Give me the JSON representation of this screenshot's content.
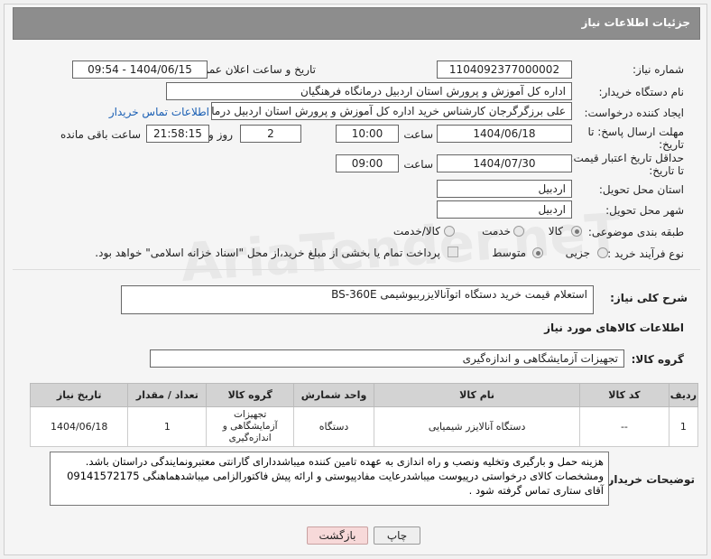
{
  "header": {
    "title": "جزئیات اطلاعات نیاز"
  },
  "watermark": "AriaTender.neT",
  "fields": {
    "need_number_label": "شماره نیاز:",
    "need_number": "1104092377000002",
    "announce_label": "تاریخ و ساعت اعلان عمومی:",
    "announce_value": "1404/06/15 - 09:54",
    "buyer_org_label": "نام دستگاه خریدار:",
    "buyer_org": "اداره کل آموزش و پرورش استان اردبیل درمانگاه فرهنگیان",
    "requester_label": "ایجاد کننده درخواست:",
    "requester": "علی برزگرگرجان کارشناس خرید اداره کل آموزش و پرورش استان اردبیل درمانگاه",
    "contact_link": "اطلاعات تماس خریدار",
    "deadline_label_1": "مهلت ارسال پاسخ: تا",
    "deadline_label_2": "تاریخ:",
    "deadline_date": "1404/06/18",
    "time_label": "ساعت",
    "deadline_time": "10:00",
    "days_value": "2",
    "days_label": "روز و",
    "remaining_time": "21:58:15",
    "remaining_label": "ساعت باقی مانده",
    "validity_label_1": "حداقل تاریخ اعتبار قیمت:",
    "validity_label_2": "تا تاریخ:",
    "validity_date": "1404/07/30",
    "validity_time": "09:00",
    "province_label": "استان محل تحویل:",
    "province": "اردبیل",
    "city_label": "شهر محل تحویل:",
    "city": "اردبیل",
    "category_label": "طبقه بندی موضوعی:",
    "category_options": [
      "کالا",
      "خدمت",
      "کالا/خدمت"
    ],
    "process_label": "نوع فرآیند خرید :",
    "process_options": [
      "جزیی",
      "متوسط"
    ],
    "payment_note": "پرداخت تمام یا بخشی از مبلغ خرید،از محل \"اسناد خزانه اسلامی\" خواهد بود.",
    "summary_label": "شرح کلی نیاز:",
    "summary": "استعلام قیمت خرید دستگاه اتوآنالایزربیوشیمی BS-360E"
  },
  "goods": {
    "section_title": "اطلاعات کالاهای مورد نیاز",
    "group_label": "گروه کالا:",
    "group_value": "تجهیزات آزمایشگاهی و اندازه‌گیری",
    "columns": [
      "ردیف",
      "کد کالا",
      "نام کالا",
      "واحد شمارش",
      "گروه کالا",
      "تعداد / مقدار",
      "تاریخ نیاز"
    ],
    "rows": [
      {
        "row": "1",
        "code": "--",
        "name": "دستگاه آنالایزر شیمیایی",
        "unit": "دستگاه",
        "group": "تجهیزات آزمایشگاهی و اندازه‌گیری",
        "qty": "1",
        "date": "1404/06/18"
      }
    ]
  },
  "buyer_notes": {
    "label": "توضیحات خریدار:",
    "text": "هزینه حمل و بارگیری وتخلیه ونصب و راه اندازی به عهده تامین کننده میباشددارای گارانتی معتبرونمایندگی دراستان باشد. ومشخصات کالای درخواستی درپیوست میباشدرعایت مفادپیوستی و ارائه پیش فاکتورالزامی میباشدهماهنگی 09141572175 آقای ستاری تماس گرفته شود ."
  },
  "buttons": {
    "print": "چاپ",
    "back": "بازگشت"
  }
}
